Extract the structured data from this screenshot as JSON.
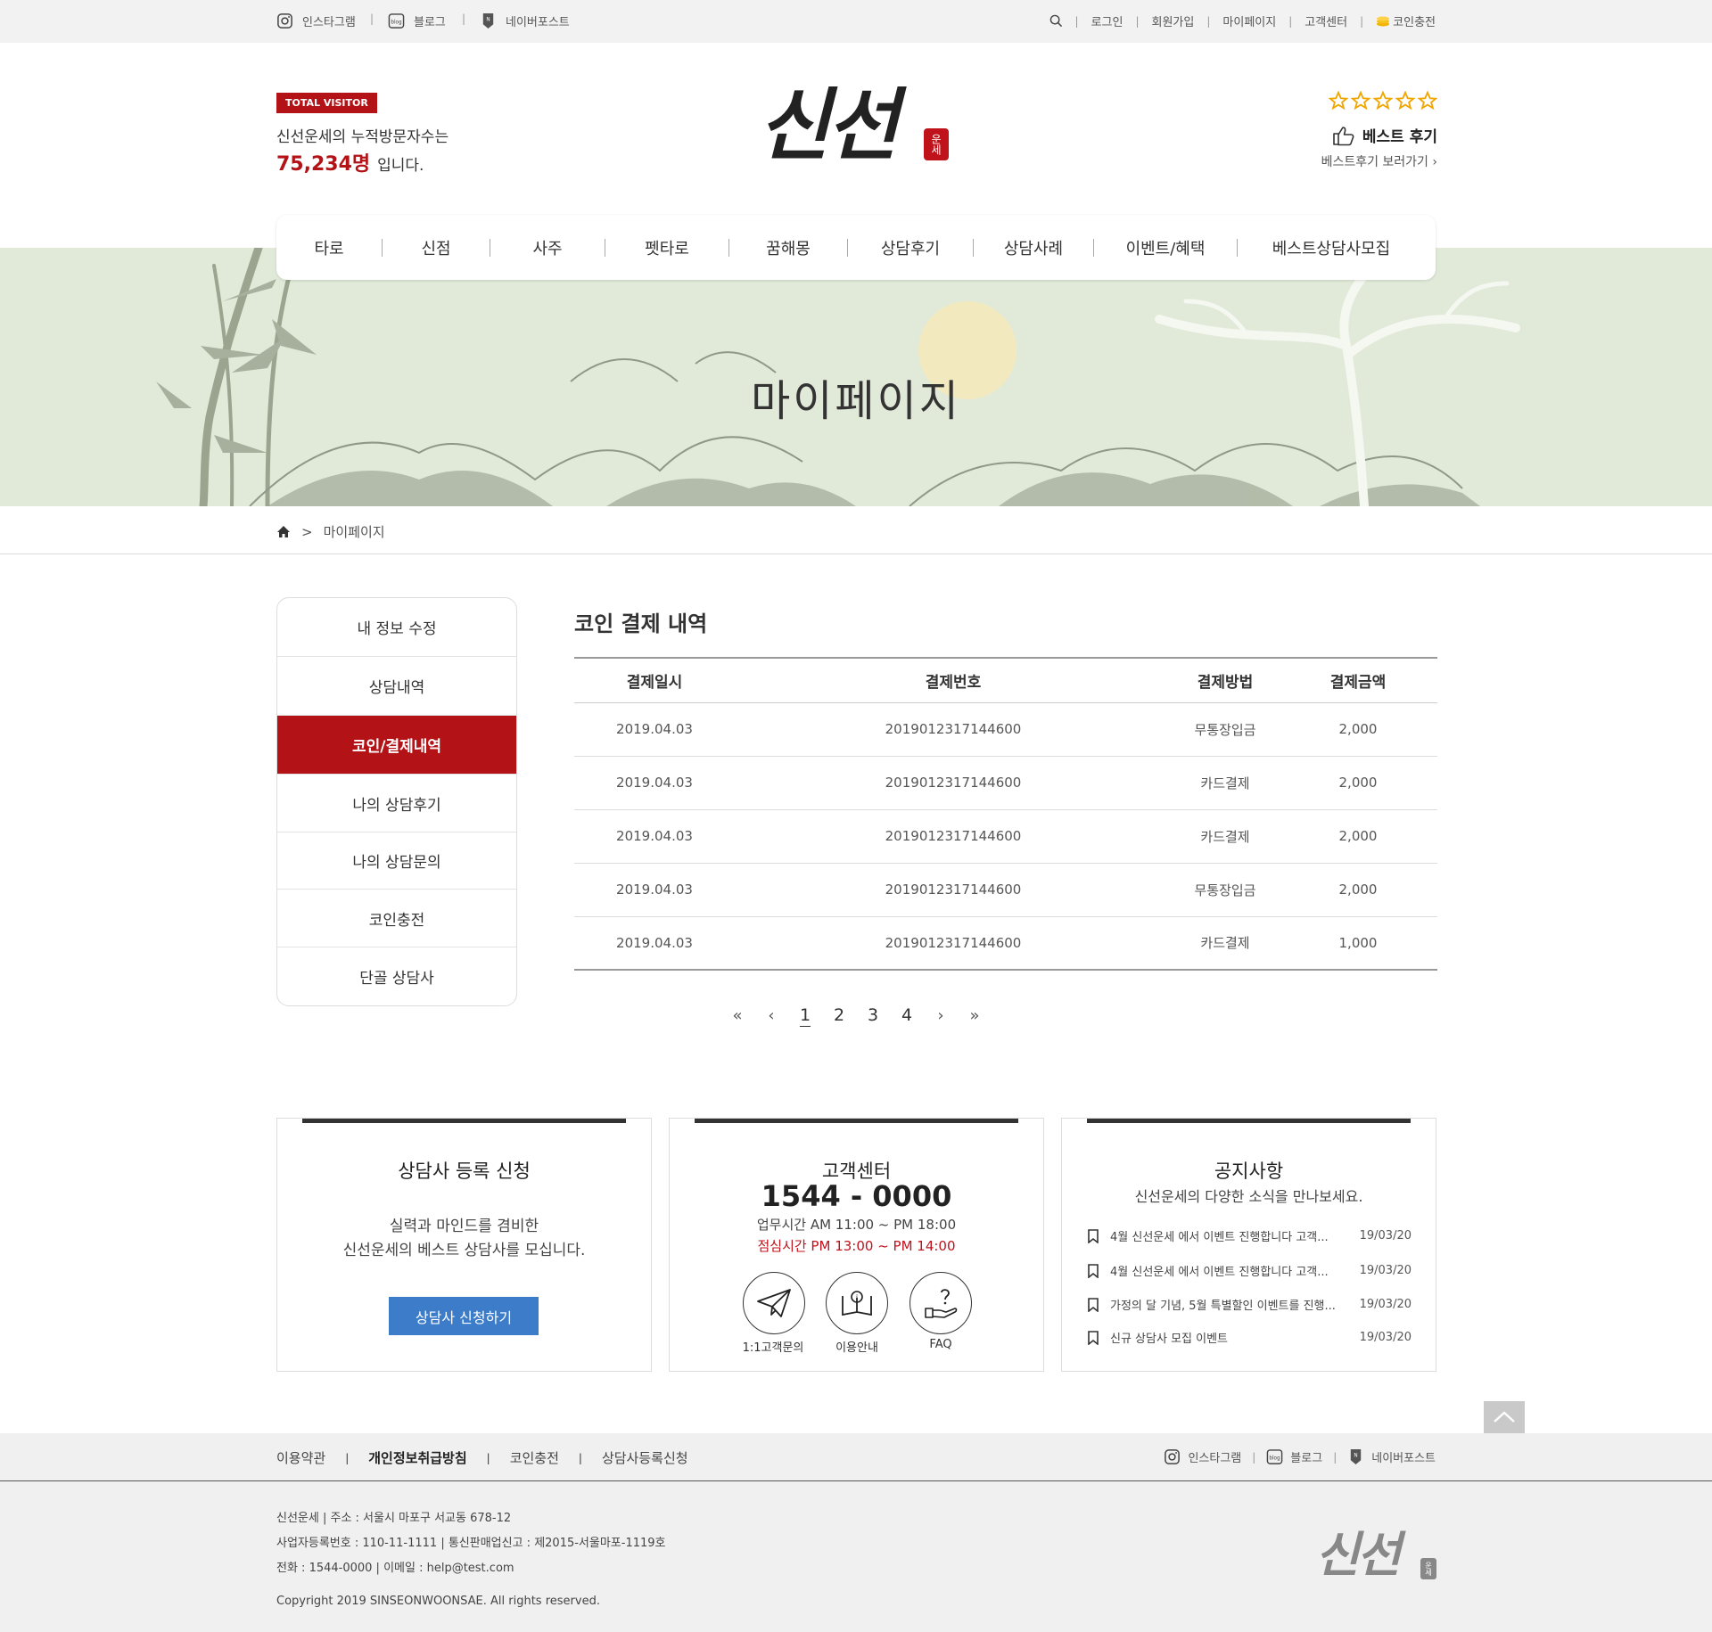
{
  "topbar": {
    "social": [
      {
        "label": "인스타그램",
        "icon": "instagram-icon"
      },
      {
        "label": "블로그",
        "icon": "blog-icon"
      },
      {
        "label": "네이버포스트",
        "icon": "naver-post-icon"
      }
    ],
    "links": [
      "로그인",
      "회원가입",
      "마이페이지",
      "고객센터"
    ],
    "coin_charge": "코인충전"
  },
  "header": {
    "visitor_badge": "TOTAL VISITOR",
    "visitor_text": "신선운세의 누적방문자수는",
    "visitor_count": "75,234명",
    "visitor_suffix": "입니다.",
    "logo_text": "신선",
    "logo_stamp": "운세",
    "best_review": "베스트 후기",
    "best_review_link": "베스트후기 보러가기",
    "stars": 5
  },
  "nav": [
    "타로",
    "신점",
    "사주",
    "펫타로",
    "꿈해몽",
    "상담후기",
    "상담사례",
    "이벤트/혜택",
    "베스트상담사모집"
  ],
  "hero": {
    "title": "마이페이지"
  },
  "breadcrumb": {
    "separator": ">",
    "current": "마이페이지"
  },
  "sidemenu": [
    "내 정보 수정",
    "상담내역",
    "코인/결제내역",
    "나의 상담후기",
    "나의 상담문의",
    "코인충전",
    "단골 상담사"
  ],
  "content": {
    "title": "코인 결제 내역",
    "columns": [
      "결제일시",
      "결제번호",
      "결제방법",
      "결제금액"
    ],
    "rows": [
      [
        "2019.04.03",
        "2019012317144600",
        "무통장입금",
        "2,000"
      ],
      [
        "2019.04.03",
        "2019012317144600",
        "카드결제",
        "2,000"
      ],
      [
        "2019.04.03",
        "2019012317144600",
        "카드결제",
        "2,000"
      ],
      [
        "2019.04.03",
        "2019012317144600",
        "무통장입금",
        "2,000"
      ],
      [
        "2019.04.03",
        "2019012317144600",
        "카드결제",
        "1,000"
      ]
    ],
    "pages": [
      "1",
      "2",
      "3",
      "4"
    ],
    "current_page": "1"
  },
  "boxes": {
    "recruit": {
      "title": "상담사 등록 신청",
      "desc1": "실력과 마인드를 겸비한",
      "desc2": "신선운세의 베스트 상담사를 모십니다.",
      "button": "상담사 신청하기"
    },
    "cs": {
      "title": "고객센터",
      "phone": "1544 - 0000",
      "hours": "업무시간 AM 11:00 ~ PM 18:00",
      "lunch": "점심시간 PM 13:00 ~ PM 14:00",
      "icons": [
        {
          "label": "1:1고객문의",
          "icon": "paper-plane-icon"
        },
        {
          "label": "이용안내",
          "icon": "book-info-icon"
        },
        {
          "label": "FAQ",
          "icon": "question-hand-icon"
        }
      ]
    },
    "notice": {
      "title": "공지사항",
      "subtitle": "신선운세의 다양한 소식을 만나보세요.",
      "items": [
        {
          "text": "4월 신선운세 에서 이벤트 진행합니다 고객...",
          "date": "19/03/20"
        },
        {
          "text": "4월 신선운세 에서 이벤트 진행합니다 고객...",
          "date": "19/03/20"
        },
        {
          "text": "가정의 달 기념, 5월 특별할인 이벤트를 진행...",
          "date": "19/03/20"
        },
        {
          "text": "신규 상담사 모집 이벤트",
          "date": "19/03/20"
        }
      ]
    }
  },
  "footer": {
    "links": [
      "이용약관",
      "개인정보취급방침",
      "코인충전",
      "상담사등록신청"
    ],
    "social": [
      "인스타그램",
      "블로그",
      "네이버포스트"
    ],
    "line1": "신선운세  |  주소 : 서울시 마포구 서교동 678-12",
    "line2": "사업자등록번호 : 110-11-1111  |  통신판매업신고 : 제2015-서울마포-1119호",
    "line3": "전화 : 1544-0000   |   이메일 : help@test.com",
    "copyright": "Copyright 2019 SINSEONWOONSAE. All rights reserved."
  },
  "colors": {
    "accent": "#b31217",
    "button": "#3d7cc9",
    "hero_bg": "#e1ead9"
  }
}
